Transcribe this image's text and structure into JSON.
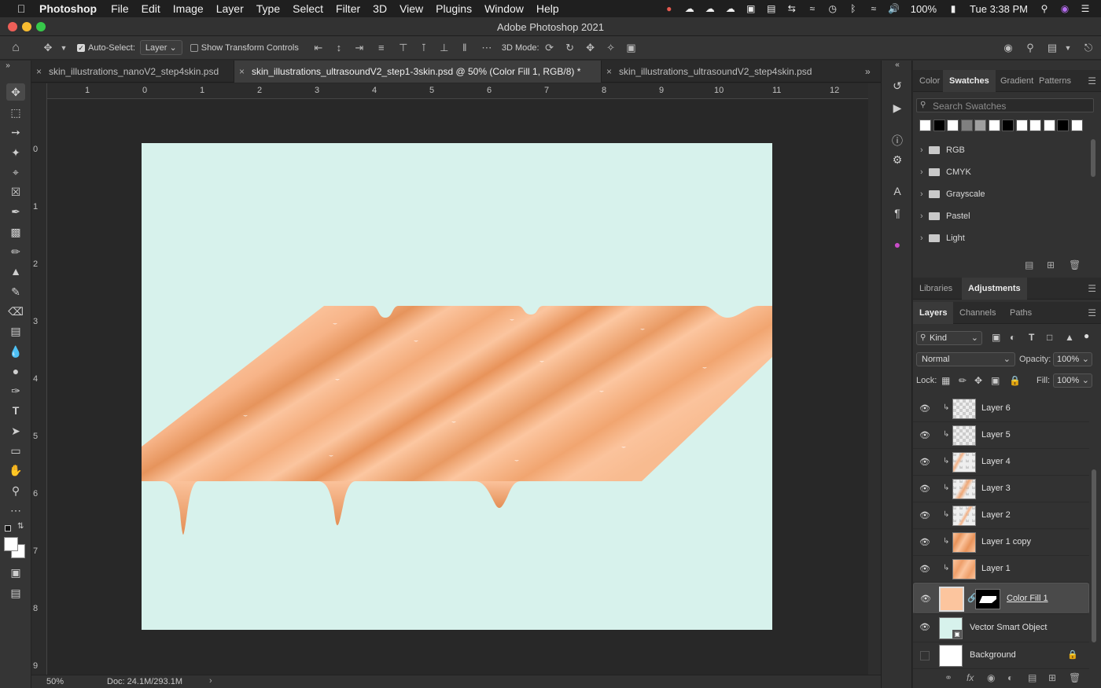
{
  "menubar": {
    "app_name": "Photoshop",
    "items": [
      "File",
      "Edit",
      "Image",
      "Layer",
      "Type",
      "Select",
      "Filter",
      "3D",
      "View",
      "Plugins",
      "Window",
      "Help"
    ],
    "battery": "100%",
    "clock": "Tue 3:38 PM"
  },
  "window": {
    "title": "Adobe Photoshop 2021"
  },
  "options_bar": {
    "auto_select_label": "Auto-Select:",
    "auto_select_checked": true,
    "auto_select_target": "Layer",
    "show_transform_label": "Show Transform Controls",
    "three_d_mode_label": "3D Mode:"
  },
  "document_tabs": [
    {
      "name": "skin_illustrations_nanoV2_step4skin.psd",
      "active": false
    },
    {
      "name": "skin_illustrations_ultrasoundV2_step1-3skin.psd @ 50% (Color Fill 1, RGB/8) *",
      "active": true
    },
    {
      "name": "skin_illustrations_ultrasoundV2_step4skin.psd",
      "active": false
    }
  ],
  "rulers": {
    "horizontal": [
      "1",
      "0",
      "1",
      "2",
      "3",
      "4",
      "5",
      "6",
      "7",
      "8",
      "9",
      "10",
      "11",
      "12"
    ],
    "vertical": [
      "0",
      "1",
      "2",
      "3",
      "4",
      "5",
      "6",
      "7",
      "8",
      "9"
    ]
  },
  "status": {
    "zoom": "50%",
    "doc_size": "Doc: 24.1M/293.1M"
  },
  "swatches_panel": {
    "tabs": [
      "Color",
      "Swatches",
      "Gradient",
      "Patterns"
    ],
    "active_tab": "Swatches",
    "search_placeholder": "Search Swatches",
    "recent_colors": [
      "#ffffff",
      "#000000",
      "#ffffff",
      "#808080",
      "#a0a0a0",
      "#ffffff",
      "#000000",
      "#ffffff",
      "#ffffff",
      "#ffffff",
      "#000000",
      "#ffffff"
    ],
    "groups": [
      "RGB",
      "CMYK",
      "Grayscale",
      "Pastel",
      "Light"
    ]
  },
  "libraries_panel": {
    "tabs": [
      "Libraries",
      "Adjustments"
    ],
    "active_tab": "Adjustments"
  },
  "layers_panel": {
    "tabs": [
      "Layers",
      "Channels",
      "Paths"
    ],
    "active_tab": "Layers",
    "filter_kind": "Kind",
    "blend_mode": "Normal",
    "opacity_label": "Opacity:",
    "opacity_value": "100%",
    "lock_label": "Lock:",
    "fill_label": "Fill:",
    "fill_value": "100%",
    "layers": [
      {
        "name": "Layer 6",
        "visible": true,
        "clipped": true,
        "selected": false
      },
      {
        "name": "Layer 5",
        "visible": true,
        "clipped": true,
        "selected": false
      },
      {
        "name": "Layer 4",
        "visible": true,
        "clipped": true,
        "selected": false
      },
      {
        "name": "Layer 3",
        "visible": true,
        "clipped": true,
        "selected": false
      },
      {
        "name": "Layer 2",
        "visible": true,
        "clipped": true,
        "selected": false
      },
      {
        "name": "Layer 1 copy",
        "visible": true,
        "clipped": true,
        "selected": false
      },
      {
        "name": "Layer 1",
        "visible": true,
        "clipped": true,
        "selected": false
      },
      {
        "name": "Color Fill 1",
        "visible": true,
        "clipped": false,
        "selected": true
      },
      {
        "name": "Vector Smart Object",
        "visible": true,
        "clipped": false,
        "selected": false
      },
      {
        "name": "Background",
        "visible": false,
        "clipped": false,
        "selected": false
      }
    ]
  },
  "colors": {
    "canvas_background": "#d7f2ec",
    "skin_base": "#fcc59e",
    "skin_shadow": "#e8935a",
    "accent_blue": "#2f6ee6"
  }
}
